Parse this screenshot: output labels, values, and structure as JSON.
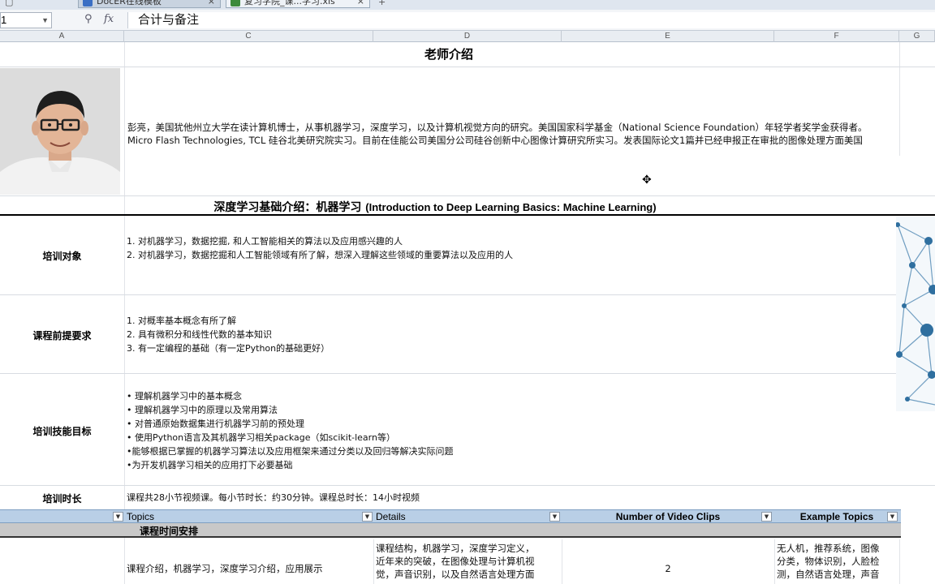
{
  "tabs": [
    {
      "label": "DocER在线模板"
    },
    {
      "label": "复习学院_课...学习.xls"
    }
  ],
  "new_tab": "+",
  "formula_bar": {
    "name_box": "1",
    "formula": "合计与备注"
  },
  "columns": [
    "A",
    "C",
    "D",
    "E",
    "F",
    "G"
  ],
  "sheet": {
    "teacher_title": "老师介绍",
    "bio_line1": "彭亮，美国犹他州立大学在读计算机博士，从事机器学习，深度学习，以及计算机视觉方向的研究。美国国家科学基金（National Science Foundation）年轻学者奖学金获得者。",
    "bio_line2": "Micro Flash Technologies, TCL 硅谷北美研究院实习。目前在佳能公司美国分公司硅谷创新中心图像计算研究所实习。发表国际论文1篇并已经申报正在审批的图像处理方面美国",
    "course_title_cn": "深度学习基础介绍：机器学习",
    "course_title_en": "(Introduction to Deep Learning Basics: Machine Learning)",
    "sections": [
      {
        "label": "培训对象",
        "lines": [
          "1. 对机器学习，数据挖掘, 和人工智能相关的算法以及应用感兴趣的人",
          "2. 对机器学习，数据挖掘和人工智能领域有所了解，想深入理解这些领域的重要算法以及应用的人"
        ]
      },
      {
        "label": "课程前提要求",
        "lines": [
          "1. 对概率基本概念有所了解",
          "2. 具有微积分和线性代数的基本知识",
          "3. 有一定编程的基础（有一定Python的基础更好）"
        ]
      },
      {
        "label": "培训技能目标",
        "lines": [
          "• 理解机器学习中的基本概念",
          "• 理解机器学习中的原理以及常用算法",
          "• 对普通原始数据集进行机器学习前的预处理",
          "• 使用Python语言及其机器学习相关package（如scikit-learn等）",
          "•能够根据已掌握的机器学习算法以及应用框架来通过分类以及回归等解决实际问题",
          "•为开发机器学习相关的应用打下必要基础"
        ]
      },
      {
        "label": "培训时长",
        "lines": [
          "课程共28小节视频课。每小节时长：约30分钟。课程总时长：14小时视频"
        ]
      }
    ],
    "table_headers": {
      "topics": "Topics",
      "details": "Details",
      "clips": "Number of Video Clips",
      "examples": "Example Topics"
    },
    "schedule_label": "课程时间安排",
    "first_row": {
      "topic": "课程介绍，机器学习，深度学习介绍，应用展示",
      "details_1": "课程结构，机器学习，深度学习定义，",
      "details_2": "近年来的突破，在图像处理与计算机视",
      "details_3": "觉，声音识别，以及自然语言处理方面",
      "clips": "2",
      "examples_1": "无人机，推荐系统，图像",
      "examples_2": "分类，物体识别，人脸检",
      "examples_3": "测，自然语言处理，声音"
    }
  },
  "colors": {
    "filter_header": "#b9cfe6",
    "schedule_bar": "#c8c8c8",
    "border_dark": "#000000"
  }
}
